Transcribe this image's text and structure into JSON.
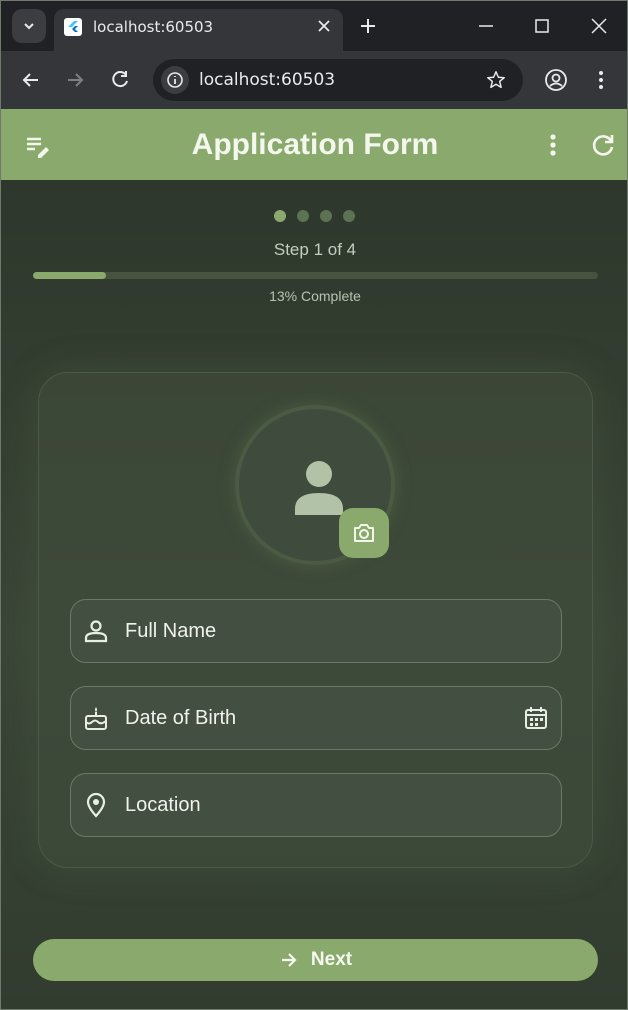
{
  "browser": {
    "tab_title": "localhost:60503",
    "url": "localhost:60503"
  },
  "appbar": {
    "title": "Application Form",
    "leading_icon": "edit-note-icon",
    "actions": [
      "more-vert-icon",
      "refresh-icon"
    ]
  },
  "progress": {
    "step_label": "Step 1 of 4",
    "current_step": 1,
    "total_steps": 4,
    "percent": 13,
    "percent_label": "13% Complete"
  },
  "form": {
    "fields": [
      {
        "label": "Full Name",
        "icon": "person-outline-icon"
      },
      {
        "label": "Date of Birth",
        "icon": "cake-icon",
        "trailing_icon": "calendar-icon"
      },
      {
        "label": "Location",
        "icon": "location-pin-icon"
      }
    ]
  },
  "footer": {
    "next_label": "Next"
  },
  "colors": {
    "accent": "#8aa96c",
    "background": "#2f3a2d",
    "field": "#434f41"
  }
}
